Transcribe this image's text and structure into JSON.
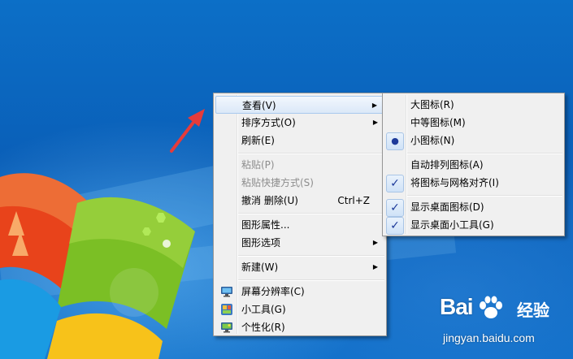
{
  "desktop": {
    "wallpaper": "windows-7-default",
    "colors": {
      "sky": "#0a5fb8",
      "flag_red": "#e8431b",
      "flag_green": "#7bbf25",
      "flag_blue": "#1a9be3",
      "flag_yellow": "#f7c21a",
      "arrow": "#e53b3b"
    }
  },
  "context_menu": {
    "items": [
      {
        "label": "查看(V)",
        "submenu": true,
        "hover": true
      },
      {
        "label": "排序方式(O)",
        "submenu": true
      },
      {
        "label": "刷新(E)"
      },
      {
        "label": "粘贴(P)",
        "disabled": true
      },
      {
        "label": "粘贴快捷方式(S)",
        "disabled": true
      },
      {
        "label": "撤消 删除(U)",
        "shortcut": "Ctrl+Z"
      },
      {
        "label": "图形属性..."
      },
      {
        "label": "图形选项",
        "submenu": true
      },
      {
        "label": "新建(W)",
        "submenu": true
      },
      {
        "label": "屏幕分辨率(C)",
        "icon": "display-icon"
      },
      {
        "label": "小工具(G)",
        "icon": "gadgets-icon"
      },
      {
        "label": "个性化(R)",
        "icon": "personalize-icon"
      }
    ],
    "submenu_arrow": "▶"
  },
  "view_submenu": {
    "items": [
      {
        "label": "大图标(R)"
      },
      {
        "label": "中等图标(M)"
      },
      {
        "label": "小图标(N)",
        "mark": "●",
        "selected": true
      },
      {
        "label": "自动排列图标(A)"
      },
      {
        "label": "将图标与网格对齐(I)",
        "mark": "✓",
        "checked": true
      },
      {
        "label": "显示桌面图标(D)",
        "mark": "✓",
        "checked": true
      },
      {
        "label": "显示桌面小工具(G)",
        "mark": "✓",
        "checked": true
      }
    ]
  },
  "watermark": {
    "logo_text": "Bai",
    "logo_suffix": "经验",
    "url": "jingyan.baidu.com"
  }
}
